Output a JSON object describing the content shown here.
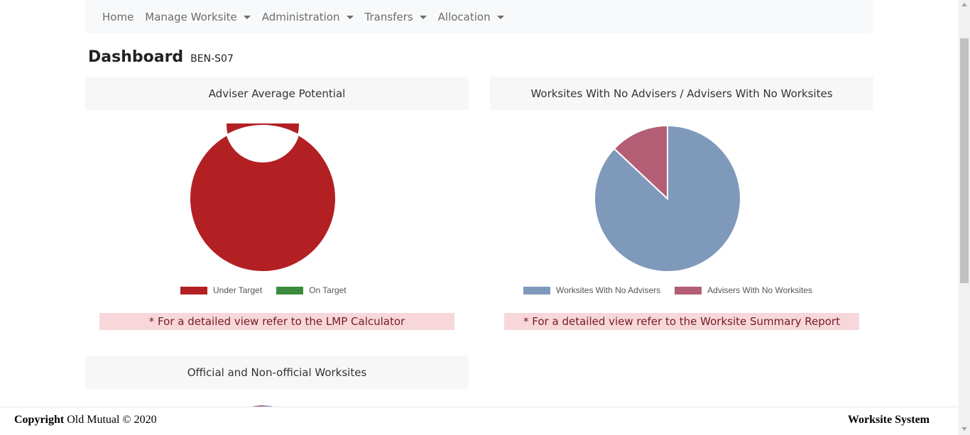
{
  "nav": {
    "items": [
      {
        "label": "Home",
        "dropdown": false
      },
      {
        "label": "Manage Worksite",
        "dropdown": true
      },
      {
        "label": "Administration",
        "dropdown": true
      },
      {
        "label": "Transfers",
        "dropdown": true
      },
      {
        "label": "Allocation",
        "dropdown": true
      }
    ]
  },
  "page": {
    "title": "Dashboard",
    "subtitle": "BEN-S07"
  },
  "cards": {
    "adviser_potential": {
      "header": "Adviser Average Potential",
      "note": "* For a detailed view refer to the LMP Calculator",
      "legend": [
        "Under Target",
        "On Target"
      ]
    },
    "worksites_advisers": {
      "header": "Worksites With No Advisers / Advisers With No Worksites",
      "note": "* For a detailed view refer to the Worksite Summary Report",
      "legend": [
        "Worksites With No Advisers",
        "Advisers With No Worksites"
      ]
    },
    "official_worksites": {
      "header": "Official and Non-official Worksites"
    }
  },
  "chart_data": [
    {
      "type": "pie",
      "variant": "doughnut",
      "labels": [
        "Under Target",
        "On Target"
      ],
      "values": [
        100,
        0
      ],
      "colors": [
        "#b22024",
        "#3d8b3d"
      ],
      "legend_position": "bottom"
    },
    {
      "type": "pie",
      "labels": [
        "Worksites With No Advisers",
        "Advisers With No Worksites"
      ],
      "values": [
        87,
        13
      ],
      "colors": [
        "#7f99bb",
        "#b35e74"
      ],
      "legend_position": "bottom"
    }
  ],
  "footer": {
    "copyright_bold": "Copyright",
    "copyright_text": " Old Mutual © 2020",
    "system_name": "Worksite System"
  }
}
